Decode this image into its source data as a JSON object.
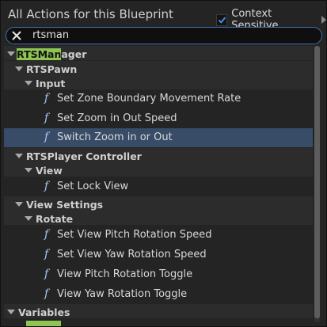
{
  "window": {
    "title": "All Actions for this Blueprint"
  },
  "context": {
    "label": "Context Sensitive",
    "checked": true
  },
  "search": {
    "value": "rtsman"
  },
  "tree": {
    "rtsmanager": {
      "match": "RTSMan",
      "rest": "ager"
    },
    "rtspawn": "RTSPawn",
    "input": "Input",
    "set_zone_boundary": "Set Zone Boundary Movement Rate",
    "set_zoom_speed": "Set Zoom in Out Speed",
    "switch_zoom": "Switch Zoom in or Out",
    "rtsplayer_controller": "RTSPlayer Controller",
    "view": "View",
    "set_lock_view": "Set Lock View",
    "view_settings": "View Settings",
    "rotate": "Rotate",
    "set_pitch_speed": "Set View Pitch Rotation Speed",
    "set_yaw_speed": "Set View Yaw Rotation Speed",
    "pitch_toggle": "View Pitch Rotation Toggle",
    "yaw_toggle": "View Yaw Rotation Toggle",
    "variables": "Variables"
  },
  "icons": {
    "function": "f"
  },
  "colors": {
    "highlight": "#8ec451",
    "selection": "#384c68",
    "function_icon": "#a6c7f2",
    "checkbox_check": "#4a8ae0"
  }
}
